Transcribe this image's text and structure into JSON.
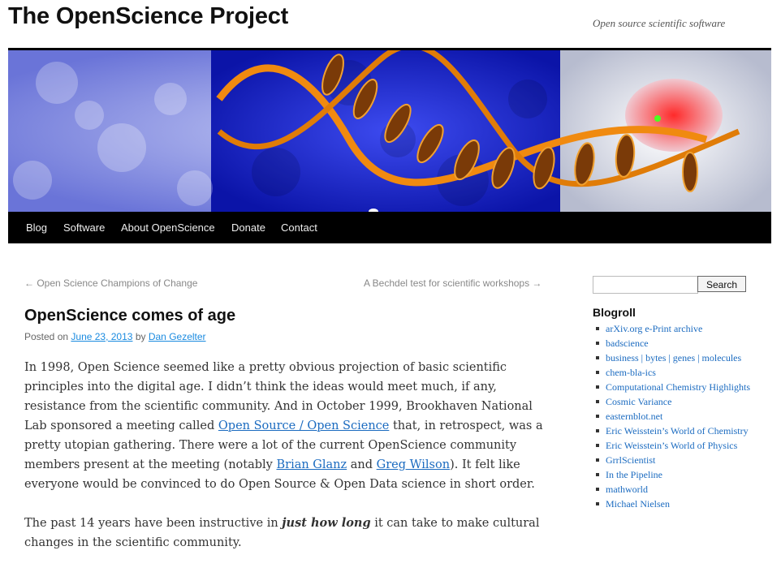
{
  "site": {
    "title": "The OpenScience Project",
    "tagline": "Open source scientific software"
  },
  "nav": {
    "items": [
      "Blog",
      "Software",
      "About OpenScience",
      "Donate",
      "Contact"
    ]
  },
  "post_nav": {
    "prev": "← Open Science Champions of Change",
    "next": "A Bechdel test for scientific workshops →"
  },
  "post": {
    "title": "OpenScience comes of age",
    "posted_on": "Posted on",
    "date": "June 23, 2013",
    "by": "by",
    "author": "Dan Gezelter",
    "p1_a": "In 1998, Open Science seemed like a pretty obvious projection of basic scientific principles into the digital age.  I didn’t think the ideas would meet much, if any, resistance from the scientific community.   And in October 1999, Brookhaven National Lab sponsored a meeting called ",
    "p1_link1": "Open Source / Open Science",
    "p1_b": " that, in retrospect, was a pretty utopian gathering.  There were a lot of the current OpenScience community members present at the meeting (notably ",
    "p1_link2": "Brian Glanz",
    "p1_c": " and ",
    "p1_link3": "Greg Wilson",
    "p1_d": ").   It felt like everyone would be convinced to do Open Source & Open Data science in short order.",
    "p2_a": "The past 14 years have been instructive in ",
    "p2_em": "just how long",
    "p2_b": " it can take to make cultural changes in the scientific community."
  },
  "sidebar": {
    "search_placeholder": "",
    "search_button": "Search",
    "blogroll_title": "Blogroll",
    "blogroll": [
      "arXiv.org e-Print archive",
      "badscience",
      "business | bytes | genes | mole­cules",
      "chem-bla-ics",
      "Computational Chemistry High­lights",
      "Cosmic Variance",
      "easternblot.net",
      "Eric Weisstein’s World of Chem­istry",
      "Eric Weisstein’s World of Physics",
      "GrrlScientist",
      "In the Pipeline",
      "mathworld",
      "Michael Nielsen"
    ]
  },
  "colors": {
    "nav_bg": "#000000",
    "link": "#1b6bc0",
    "banner_blue": "#2a3ae0",
    "banner_orange": "#f08a10",
    "banner_red": "#e01818"
  }
}
